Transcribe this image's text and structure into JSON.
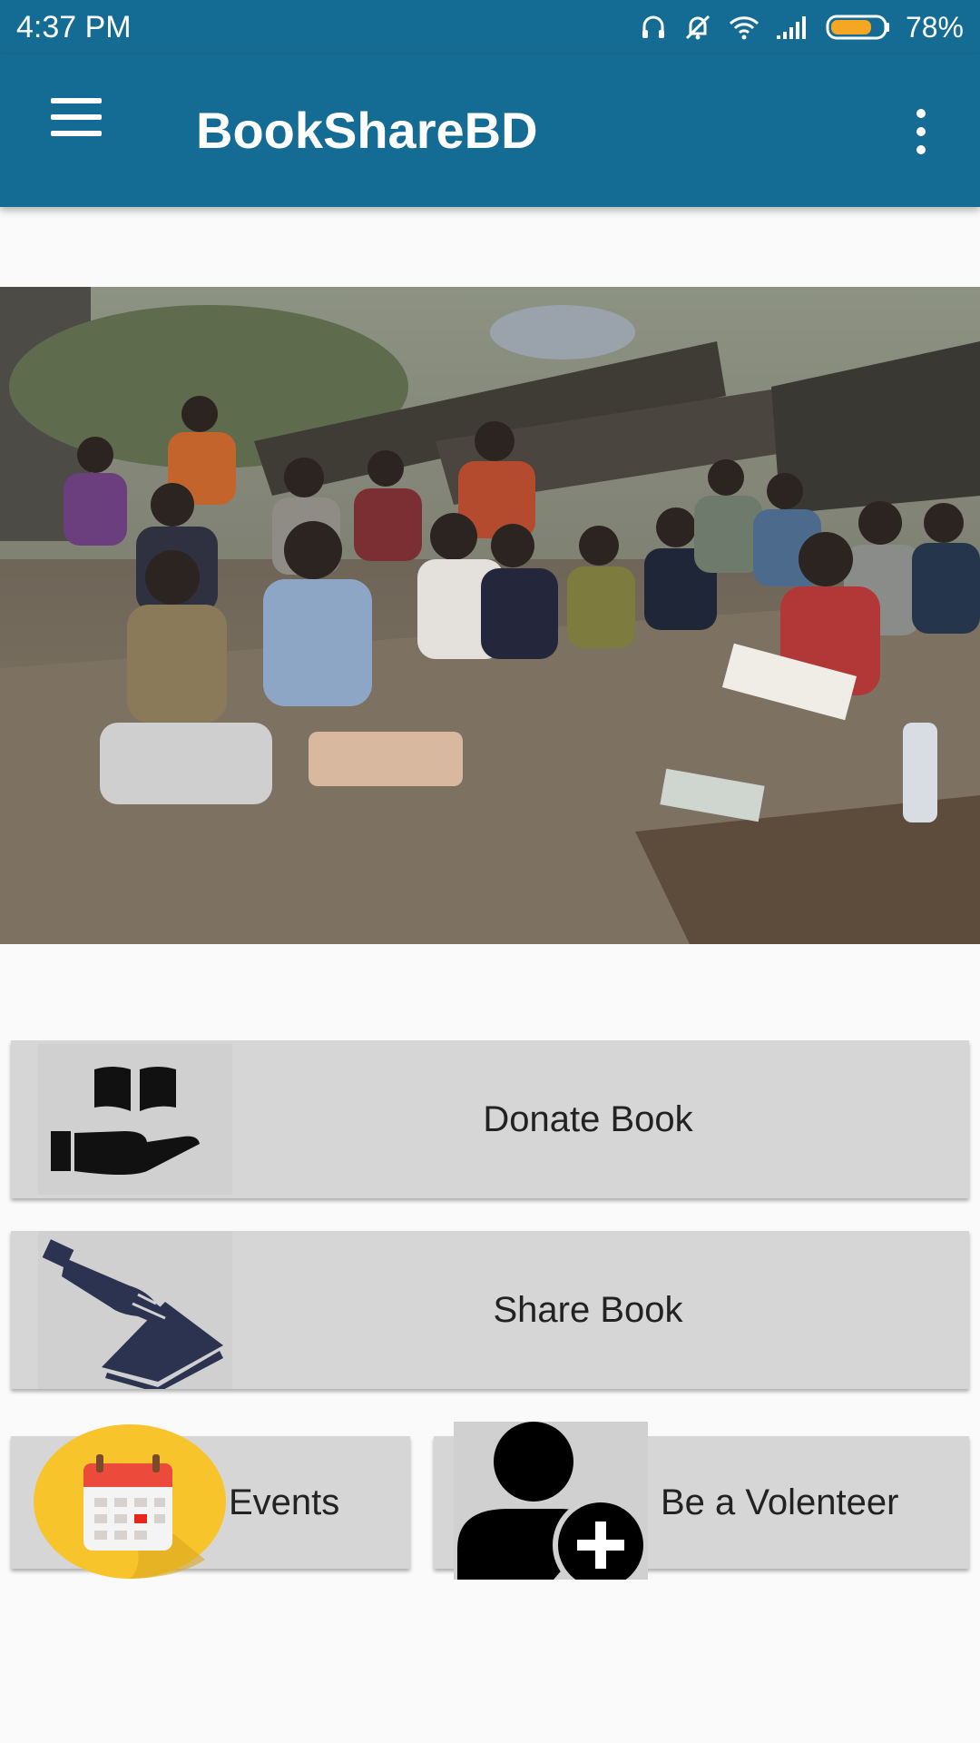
{
  "status_bar": {
    "time": "4:37 PM",
    "battery_percent": "78%",
    "battery_level": 0.78,
    "icons": [
      "headset-icon",
      "muted-bell-icon",
      "wifi-icon",
      "signal-icon",
      "battery-icon"
    ]
  },
  "app_bar": {
    "title": "BookShareBD",
    "left_icon": "hamburger-menu-icon",
    "right_icon": "overflow-menu-icon"
  },
  "hero": {
    "description": "children-studying-outdoors-photo"
  },
  "actions": {
    "donate": {
      "label": "Donate Book",
      "icon": "donate-book-icon"
    },
    "share": {
      "label": "Share Book",
      "icon": "share-book-icon"
    },
    "events": {
      "label": "Events",
      "icon": "calendar-icon"
    },
    "volunteer": {
      "label": "Be a Volenteer",
      "icon": "add-user-icon"
    }
  },
  "colors": {
    "primary": "#146c94",
    "card": "#d6d6d6",
    "background": "#fafafa",
    "battery_fill": "#f5a623",
    "calendar_circle": "#f7c42c"
  }
}
